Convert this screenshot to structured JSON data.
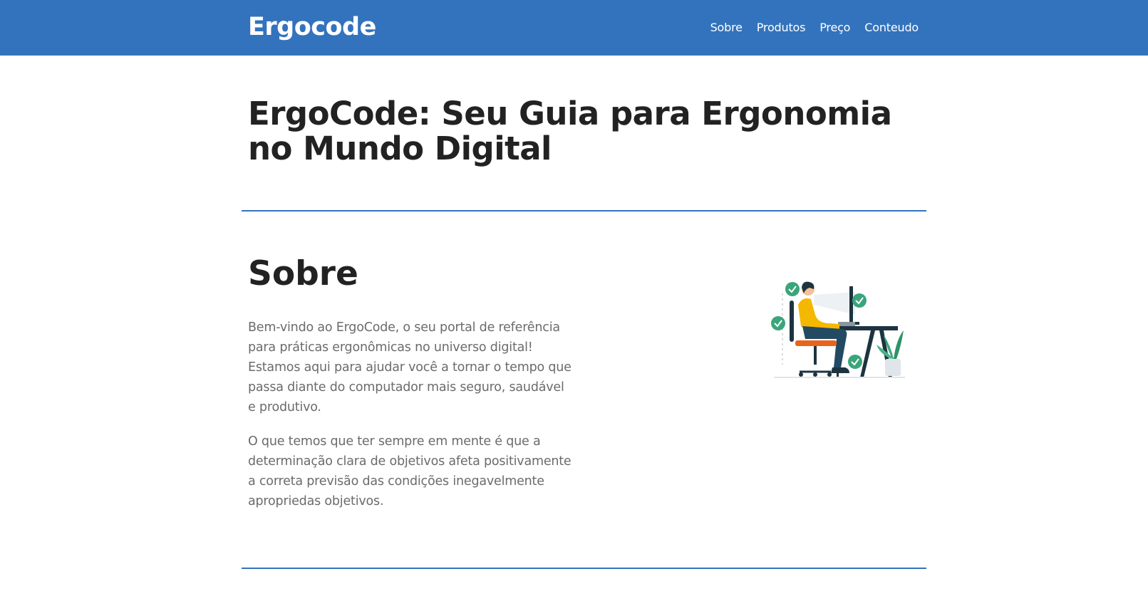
{
  "header": {
    "brand": "Ergocode",
    "nav": [
      {
        "label": "Sobre"
      },
      {
        "label": "Produtos"
      },
      {
        "label": "Preço"
      },
      {
        "label": "Conteudo"
      }
    ]
  },
  "hero": {
    "title": "ErgoCode: Seu Guia para Ergonomia no Mundo Digital"
  },
  "about": {
    "title": "Sobre",
    "paragraphs": [
      "Bem-vindo ao ErgoCode, o seu portal de referência para práticas ergonômicas no universo digital! Estamos aqui para ajudar você a tornar o tempo que passa diante do computador mais seguro, saudável e produtivo.",
      "O que temos que ter sempre em mente é que a determinação clara de objetivos afeta positivamente a correta previsão das condições inegavelmente apropriedas objetivos."
    ],
    "illustration_icon": "ergonomic-workstation-illustration"
  },
  "colors": {
    "brand_blue": "#3373bd",
    "check_green": "#3aa57a",
    "shirt_yellow": "#f5b800",
    "chair_orange": "#e8641c",
    "dark_navy": "#1d3440"
  }
}
